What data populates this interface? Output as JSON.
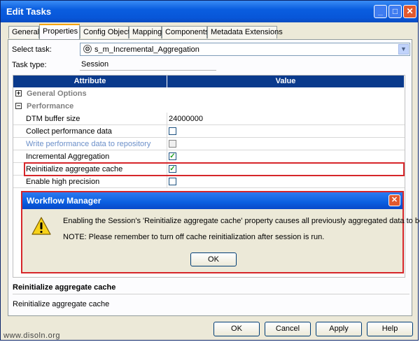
{
  "window": {
    "title": "Edit Tasks"
  },
  "tabs": [
    "General",
    "Properties",
    "Config Object",
    "Mapping",
    "Components",
    "Metadata Extensions"
  ],
  "form": {
    "select_task_label": "Select task:",
    "select_task_value": "s_m_Incremental_Aggregation",
    "task_type_label": "Task type:",
    "task_type_value": "Session"
  },
  "grid": {
    "col_attribute": "Attribute",
    "col_value": "Value",
    "groups": [
      {
        "label": "General Options",
        "expander": "+"
      },
      {
        "label": "Performance",
        "expander": "−"
      }
    ],
    "rows": [
      {
        "name": "DTM buffer size",
        "value": "24000000"
      },
      {
        "name": "Collect performance data",
        "checked": false
      },
      {
        "name": "Write performance data to repository",
        "checked": false,
        "disabled": true
      },
      {
        "name": "Incremental Aggregation",
        "checked": true
      },
      {
        "name": "Reinitialize aggregate cache",
        "checked": true
      },
      {
        "name": "Enable high precision",
        "checked": false
      }
    ]
  },
  "description": {
    "title": "Reinitialize aggregate cache",
    "text": "Reinitialize aggregate cache"
  },
  "buttons": {
    "ok": "OK",
    "cancel": "Cancel",
    "apply": "Apply",
    "help": "Help"
  },
  "dialog": {
    "title": "Workflow Manager",
    "message": "Enabling the Session's 'Reinitialize aggregate cache' property causes all previously aggregated data to be lost.",
    "note": "NOTE: Please remember to turn off cache reinitialization after session is run.",
    "ok": "OK"
  },
  "watermark": "www.disoln.org",
  "colors": {
    "title_bar": "#0a5ee0",
    "grid_header": "#0a3a8c",
    "highlight": "#d6262a",
    "check": "#21a121"
  }
}
